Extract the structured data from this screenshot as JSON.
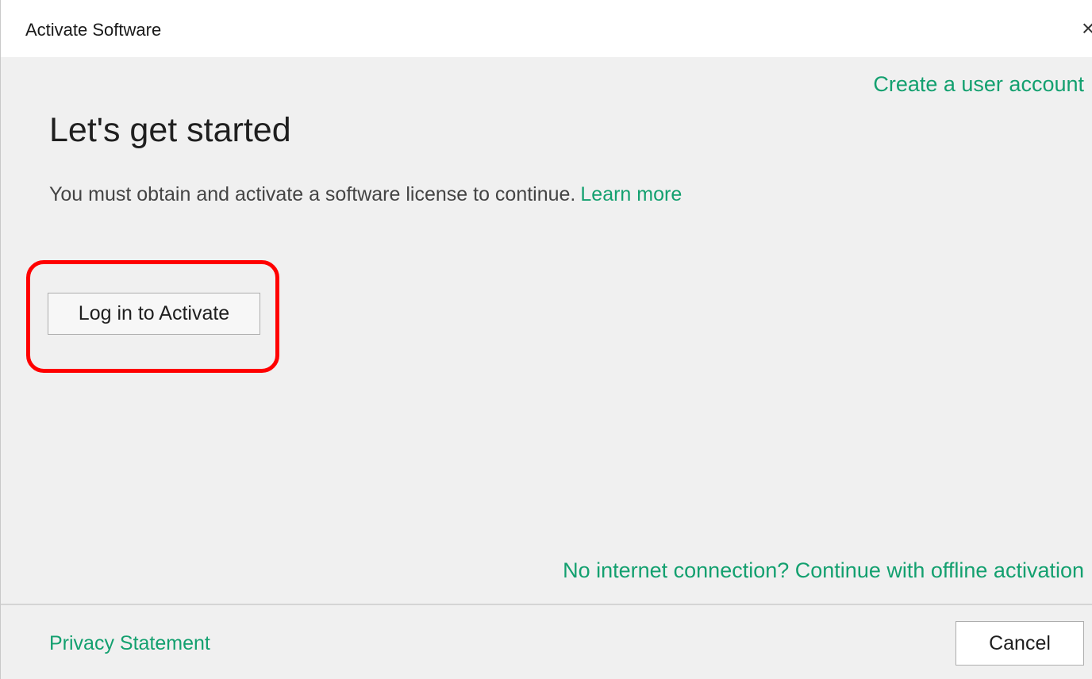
{
  "window": {
    "title": "Activate Software",
    "close_icon": "close-icon",
    "close_glyph": "×"
  },
  "header": {
    "create_account_link": "Create a user account"
  },
  "main": {
    "heading": "Let's get started",
    "intro_text": "You must obtain and activate a software license to continue.",
    "learn_more_link": "Learn more",
    "login_button": "Log in to Activate",
    "offline_link": "No internet connection? Continue with offline activation"
  },
  "footer": {
    "privacy_link": "Privacy Statement",
    "cancel_button": "Cancel"
  },
  "colors": {
    "link": "#13a06f",
    "highlight": "#ff0000",
    "background": "#f0f0f0",
    "titlebar": "#ffffff"
  }
}
